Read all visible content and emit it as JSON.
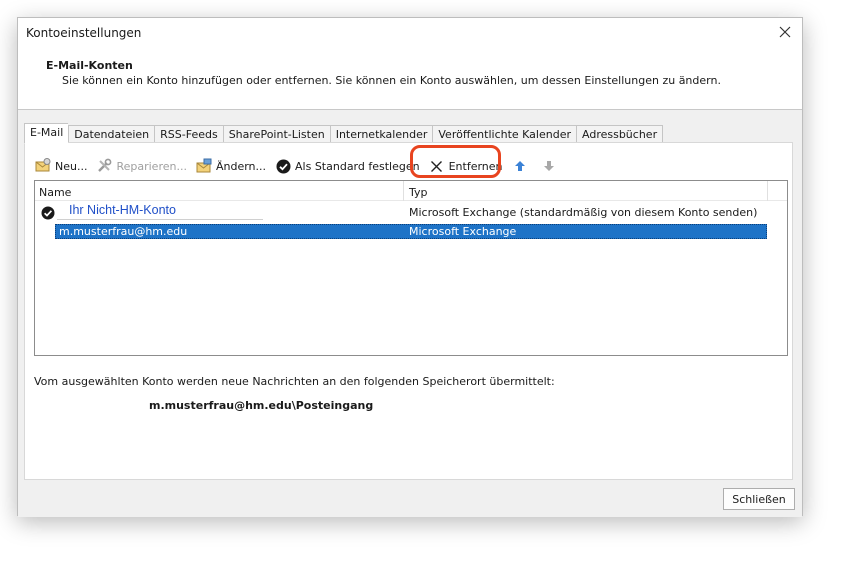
{
  "window": {
    "title": "Kontoeinstellungen"
  },
  "header": {
    "title": "E-Mail-Konten",
    "subtitle": "Sie können ein Konto hinzufügen oder entfernen. Sie können ein Konto auswählen, um dessen Einstellungen zu ändern."
  },
  "tabs": [
    {
      "label": "E-Mail",
      "active": true
    },
    {
      "label": "Datendateien"
    },
    {
      "label": "RSS-Feeds"
    },
    {
      "label": "SharePoint-Listen"
    },
    {
      "label": "Internetkalender"
    },
    {
      "label": "Veröffentlichte Kalender"
    },
    {
      "label": "Adressbücher"
    }
  ],
  "toolbar": {
    "new": "Neu...",
    "repair": "Reparieren...",
    "change": "Ändern...",
    "set_default": "Als Standard festlegen",
    "remove": "Entfernen",
    "accent": "#e8441f"
  },
  "list": {
    "columns": {
      "name": "Name",
      "type": "Typ"
    },
    "rows": [
      {
        "name": "Ihr Nicht-HM-Konto",
        "type": "Microsoft Exchange (standardmäßig von diesem Konto senden)",
        "default": true
      },
      {
        "name": "m.musterfrau@hm.edu",
        "type": "Microsoft Exchange",
        "selected": true
      }
    ]
  },
  "delivery": {
    "text": "Vom ausgewählten Konto werden neue Nachrichten an den folgenden Speicherort übermittelt:",
    "path": "m.musterfrau@hm.edu\\Posteingang"
  },
  "footer": {
    "close": "Schließen"
  }
}
